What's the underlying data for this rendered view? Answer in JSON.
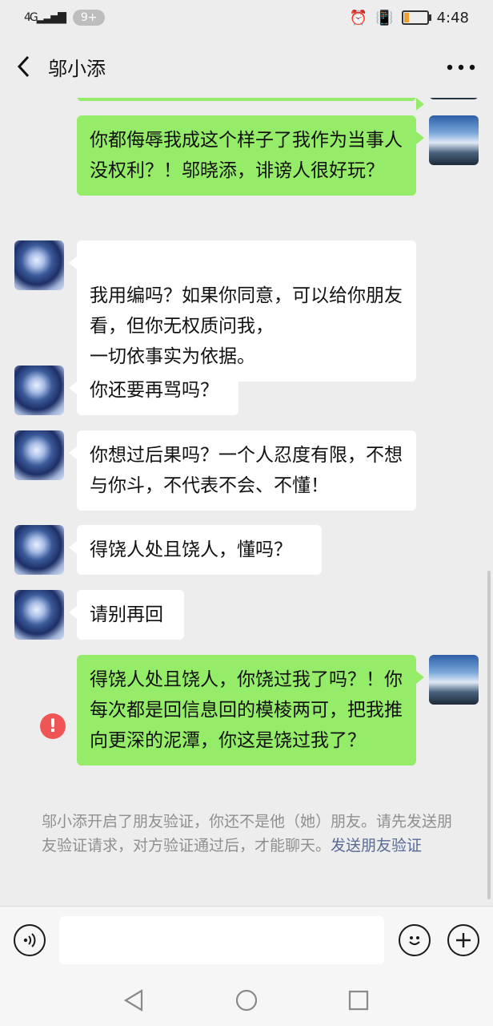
{
  "status_bar": {
    "network": "4G",
    "notif_badge": "9+",
    "time": "4:48",
    "battery_level": 0.2
  },
  "header": {
    "title": "邬小添",
    "back_icon": "chevron-left-icon",
    "more_icon": "more-icon"
  },
  "messages": [
    {
      "sender": "me",
      "text": "你都侮辱我成这个样子了我作为当事人没权利？！邬晓添，诽谤人很好玩？"
    },
    {
      "sender": "friend",
      "text": "我用编吗？如果你同意，可以给你朋友看，但你无权质问我，\n一切依事实为依据。"
    },
    {
      "sender": "friend",
      "text": "你还要再骂吗？"
    },
    {
      "sender": "friend",
      "text": "你想过后果吗？一个人忍度有限，不想与你斗，不代表不会、不懂！"
    },
    {
      "sender": "friend",
      "text": "得饶人处且饶人，懂吗？"
    },
    {
      "sender": "friend",
      "text": "请别再回"
    },
    {
      "sender": "me",
      "text": "得饶人处且饶人，你饶过我了吗？！你每次都是回信息回的模棱两可，把我推向更深的泥潭，你这是饶过我了？",
      "status": "failed"
    }
  ],
  "notice": {
    "text": "邬小添开启了朋友验证，你还不是他（她）朋友。请先发送朋友验证请求，对方验证通过后，才能聊天。",
    "link": "发送朋友验证"
  },
  "input_bar": {
    "voice_icon": "voice-icon",
    "text_value": "",
    "emoji_icon": "emoji-icon",
    "plus_icon": "plus-icon"
  },
  "nav_bar": {
    "back": "back-triangle-icon",
    "home": "home-circle-icon",
    "recents": "recents-square-icon"
  }
}
